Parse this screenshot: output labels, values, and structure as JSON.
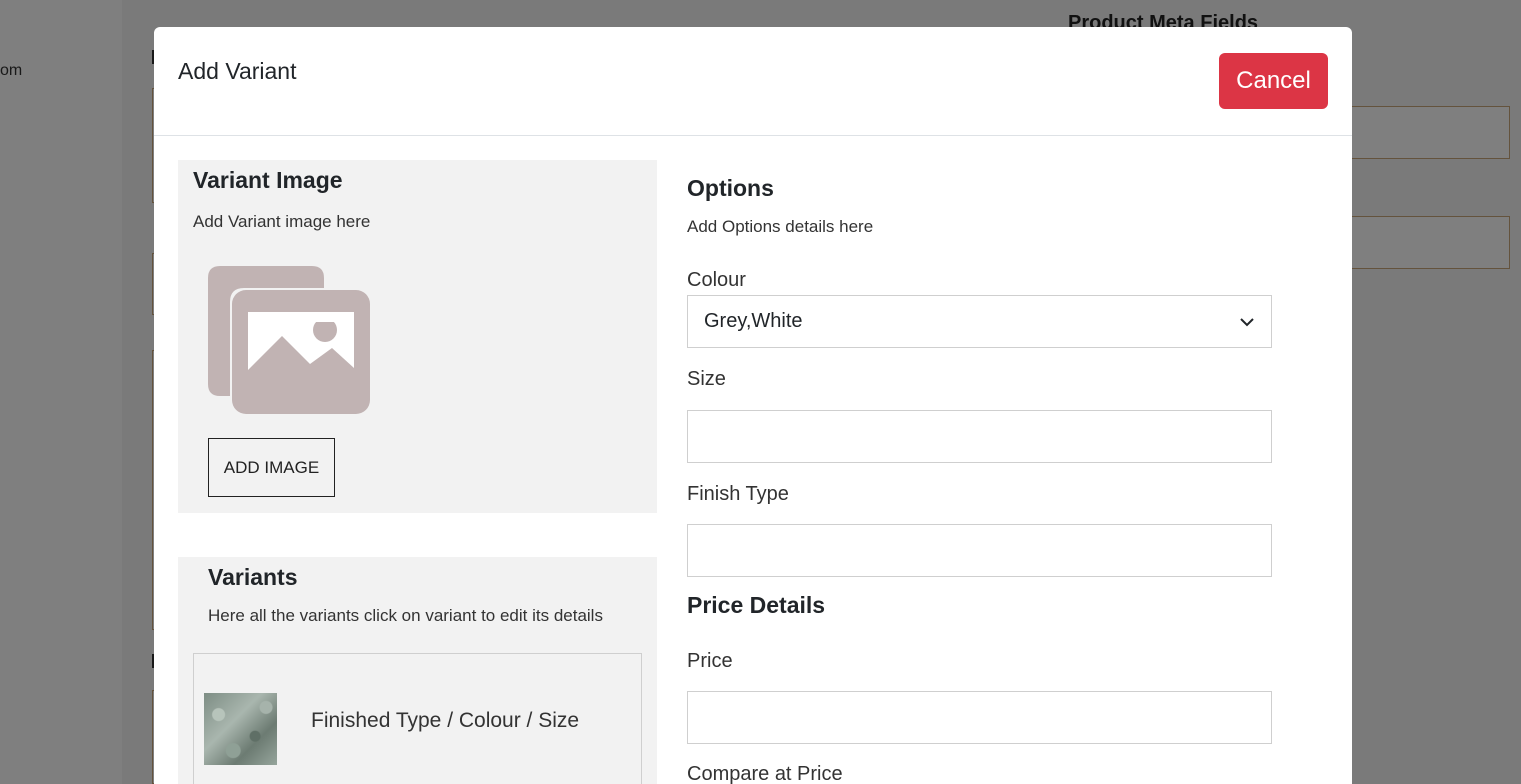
{
  "background": {
    "nav_text": "om",
    "meta_title": "Product Meta Fields"
  },
  "modal": {
    "title": "Add Variant",
    "cancel_label": "Cancel",
    "variant_image": {
      "title": "Variant Image",
      "subtitle": "Add Variant image here",
      "add_image_label": "ADD IMAGE",
      "placeholder_icon": "image-placeholder-icon"
    },
    "variants": {
      "title": "Variants",
      "subtitle": "Here all the variants click on variant to edit its details",
      "items": [
        {
          "label": "Finished Type / Colour / Size"
        }
      ]
    },
    "options": {
      "title": "Options",
      "subtitle": "Add Options details here",
      "colour_label": "Colour",
      "colour_value": "Grey,White",
      "size_label": "Size",
      "size_value": "",
      "finish_label": "Finish Type",
      "finish_value": ""
    },
    "price": {
      "title": "Price Details",
      "price_label": "Price",
      "price_value": "",
      "compare_label": "Compare at Price"
    }
  },
  "colors": {
    "cancel": "#dc3545",
    "panel_bg": "#f2f2f2",
    "backdrop": "rgba(0,0,0,0.5)",
    "placeholder_icon": "#c1b3b3"
  }
}
